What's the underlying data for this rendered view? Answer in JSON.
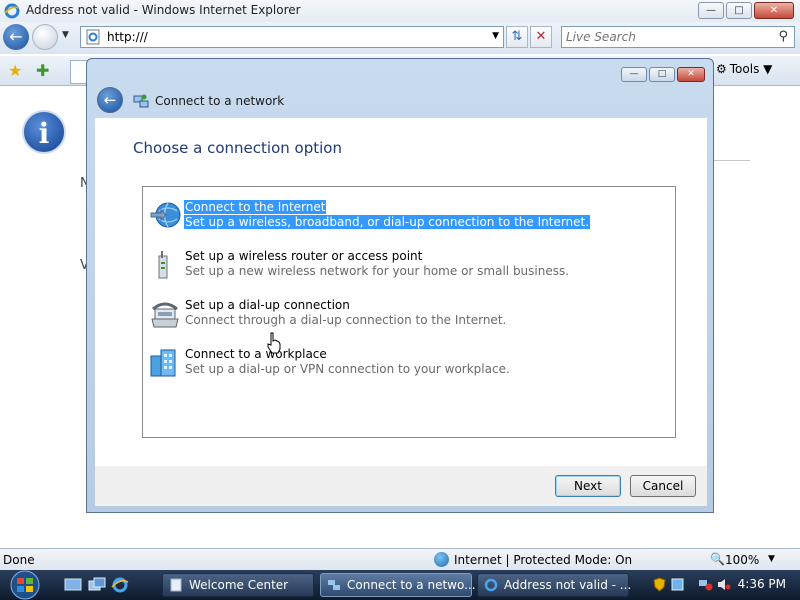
{
  "browser": {
    "window_title": "Address not valid - Windows Internet Explorer",
    "address": "http:///",
    "search_placeholder": "Live Search",
    "tools_label": "Tools",
    "status_text": "Done",
    "zone_text": "Internet | Protected Mode: On",
    "zoom_text": "100%"
  },
  "page": {
    "fragments": [
      "N",
      "V"
    ]
  },
  "dialog": {
    "title": "Connect to a network",
    "heading": "Choose a connection option",
    "options": [
      {
        "title": "Connect to the Internet",
        "description": "Set up a wireless, broadband, or dial-up connection to the Internet.",
        "icon": "globe-icon",
        "selected": true
      },
      {
        "title": "Set up a wireless router or access point",
        "description": "Set up a new wireless network for your home or small business.",
        "icon": "wireless-router-icon",
        "selected": false
      },
      {
        "title": "Set up a dial-up connection",
        "description": "Connect through a dial-up connection to the Internet.",
        "icon": "phone-modem-icon",
        "selected": false
      },
      {
        "title": "Connect to a workplace",
        "description": "Set up a dial-up or VPN connection to your workplace.",
        "icon": "workplace-icon",
        "selected": false
      }
    ],
    "next_label": "Next",
    "cancel_label": "Cancel"
  },
  "taskbar": {
    "tasks": [
      {
        "label": "Welcome Center",
        "active": false
      },
      {
        "label": "Connect to a netwo...",
        "active": true
      },
      {
        "label": "Address not valid - ...",
        "active": false
      }
    ],
    "clock": "4:36 PM"
  },
  "colors": {
    "selection": "#3399ff",
    "heading": "#1e3a78",
    "taskbar": "#1a2a44"
  }
}
